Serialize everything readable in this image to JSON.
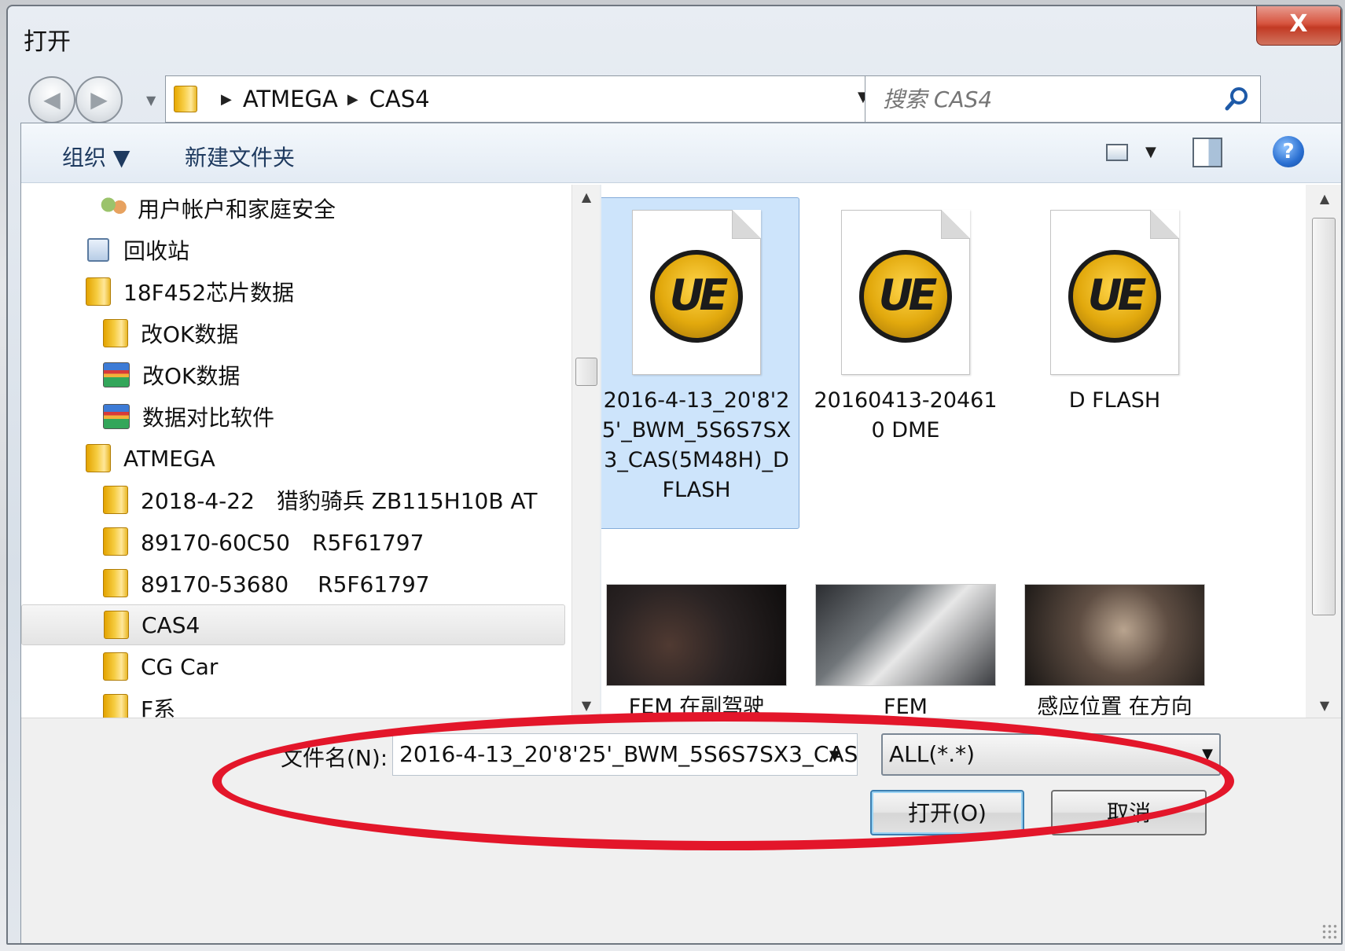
{
  "window": {
    "title": "打开",
    "close_label": "X"
  },
  "nav": {
    "back_icon": "back-arrow-icon",
    "forward_icon": "forward-arrow-icon"
  },
  "address": {
    "crumbs": [
      "ATMEGA",
      "CAS4"
    ]
  },
  "search": {
    "placeholder": "搜索 CAS4"
  },
  "toolbar": {
    "organize_label": "组织 ▼",
    "new_folder_label": "新建文件夹",
    "help_label": "?"
  },
  "tree": {
    "items": [
      {
        "label": "用户帐户和家庭安全",
        "icon": "users-icon"
      },
      {
        "label": "回收站",
        "icon": "recycle-bin-icon"
      },
      {
        "label": "18F452芯片数据",
        "icon": "folder-icon"
      },
      {
        "label": "改OK数据",
        "icon": "folder-icon"
      },
      {
        "label": "改OK数据",
        "icon": "archive-icon"
      },
      {
        "label": "数据对比软件",
        "icon": "archive-icon"
      },
      {
        "label": "ATMEGA",
        "icon": "folder-icon"
      },
      {
        "label": "2018-4-22　猎豹骑兵 ZB115H10B AT",
        "icon": "folder-icon"
      },
      {
        "label": "89170-60C50　R5F61797",
        "icon": "folder-icon"
      },
      {
        "label": "89170-53680　 R5F61797",
        "icon": "folder-icon"
      },
      {
        "label": "CAS4",
        "icon": "folder-icon",
        "selected": true
      },
      {
        "label": "CG Car",
        "icon": "folder-icon"
      },
      {
        "label": "F系",
        "icon": "folder-icon"
      }
    ]
  },
  "files": {
    "items": [
      {
        "name": "2016-4-13_20'8'25'_BWM_5S6S7SX3_CAS(5M48H)_DFLASH",
        "type": "ue-document",
        "selected": true
      },
      {
        "name": "20160413-204610 DME",
        "type": "ue-document"
      },
      {
        "name": "D FLASH",
        "type": "ue-document"
      },
      {
        "name": "FEM 在副驾驶",
        "type": "image"
      },
      {
        "name": "FEM",
        "type": "image"
      },
      {
        "name": "感应位置 在方向",
        "type": "image"
      }
    ],
    "ue_badge": "UE"
  },
  "bottom": {
    "filename_label": "文件名(N):",
    "filename_value": "2016-4-13_20'8'25'_BWM_5S6S7SX3_CAS",
    "filetype_value": "ALL(*.*)",
    "open_label": "打开(O)",
    "cancel_label": "取消"
  },
  "colors": {
    "annotation": "#e3162a",
    "selection": "#cde4fb",
    "ue_gold": "#e2a90d"
  }
}
